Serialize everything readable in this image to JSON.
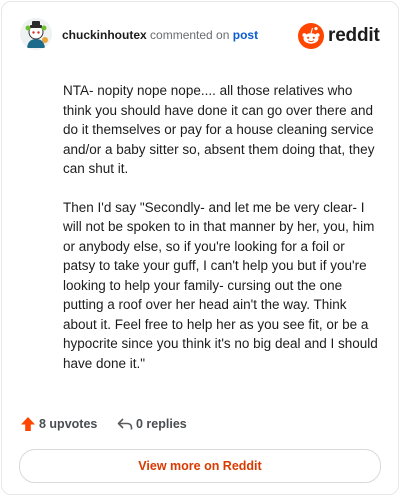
{
  "colors": {
    "accent": "#ff4500",
    "link": "#0a5bd1",
    "view_more_text": "#d93a00"
  },
  "header": {
    "username": "chuckinhoutex",
    "action_text": "commented on",
    "post_link": "post",
    "brand_name": "reddit",
    "brand_icon": "reddit-snoo-icon",
    "avatar_icon": "snoo-avatar-icon"
  },
  "comment": {
    "paragraphs": [
      "NTA- nopity nope nope.... all those relatives who think you should have done it can go over there and do it themselves or pay for a house cleaning service and/or a baby sitter so, absent them doing that, they can shut it.",
      "Then I'd say \"Secondly- and let me be very clear- I will not be spoken to in that manner by her, you, him or anybody else, so if you're looking for a foil or patsy to take your guff, I can't help you but if you're looking to help your family- cursing out the one putting a roof over her head ain't the way. Think about it. Feel free to help her as you see fit, or be a hypocrite since you think it's no big deal and I should have done it.\""
    ]
  },
  "actions": {
    "upvotes_label": "8 upvotes",
    "upvote_icon": "upvote-arrow-icon",
    "replies_label": "0 replies",
    "reply_icon": "reply-icon"
  },
  "footer": {
    "view_more_label": "View more on Reddit"
  }
}
